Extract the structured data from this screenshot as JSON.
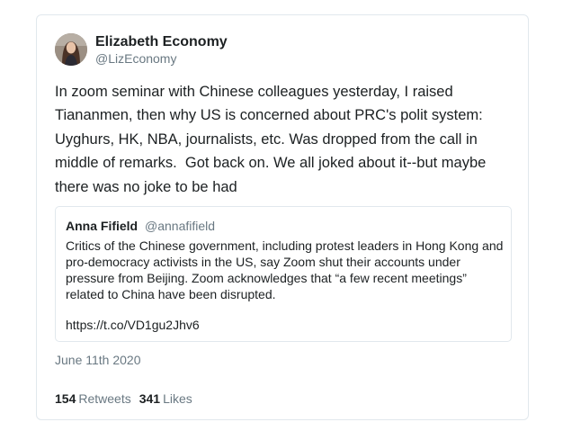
{
  "tweet": {
    "author": {
      "display_name": "Elizabeth Economy",
      "handle": "@LizEconomy"
    },
    "text": "In zoom seminar with Chinese colleagues yesterday, I raised Tiananmen, then why US is concerned about PRC's polit system: Uyghurs, HK, NBA, journalists, etc. Was dropped from the call in middle of remarks.  Got back on. We all joked about it--but maybe there was no joke to be had",
    "quoted_tweet": {
      "author_name": "Anna Fifield",
      "author_handle": "@annafifield",
      "text": "Critics of the Chinese government, including protest leaders in Hong Kong and pro-democracy activists in the US, say Zoom shut their accounts under pressure from Beijing. Zoom acknowledges that “a few recent meetings” related to China have been disrupted.",
      "link": "https://t.co/VD1gu2Jhv6"
    },
    "date": "June 11th 2020",
    "stats": {
      "retweets_count": "154",
      "retweets_label": "Retweets",
      "likes_count": "341",
      "likes_label": "Likes"
    }
  },
  "colors": {
    "text_primary": "#1c2022",
    "text_secondary": "#697882",
    "border": "#e1e8ed"
  }
}
